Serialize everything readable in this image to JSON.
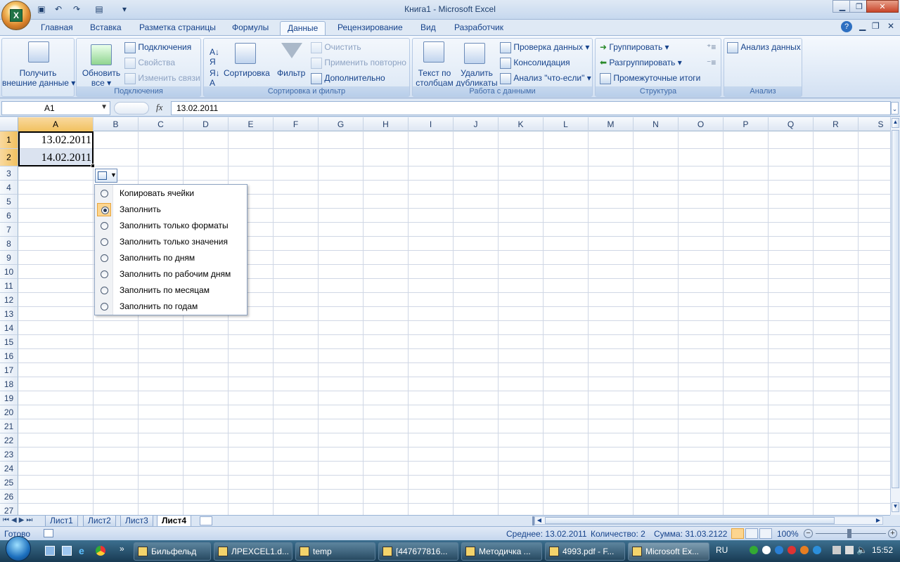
{
  "window": {
    "title": "Книга1 - Microsoft Excel",
    "minimize": "▁",
    "restore": "❐",
    "close": "✕"
  },
  "qat": {
    "save": "💾",
    "undo": "↶",
    "redo": "↷",
    "custom": "▾"
  },
  "tabs": [
    "Главная",
    "Вставка",
    "Разметка страницы",
    "Формулы",
    "Данные",
    "Рецензирование",
    "Вид",
    "Разработчик"
  ],
  "active_tab": "Данные",
  "ribbon": {
    "get_external": {
      "line1": "Получить",
      "line2": "внешние данные ▾"
    },
    "connections": {
      "refresh_line1": "Обновить",
      "refresh_line2": "все ▾",
      "connections": "Подключения",
      "properties": "Свойства",
      "edit_links": "Изменить связи",
      "label": "Подключения"
    },
    "sort_filter": {
      "sort": "Сортировка",
      "filter": "Фильтр",
      "clear": "Очистить",
      "reapply": "Применить повторно",
      "advanced": "Дополнительно",
      "label": "Сортировка и фильтр"
    },
    "data_tools": {
      "text_to_columns_1": "Текст по",
      "text_to_columns_2": "столбцам",
      "remove_dup_1": "Удалить",
      "remove_dup_2": "дубликаты",
      "validation": "Проверка данных ▾",
      "consolidate": "Консолидация",
      "whatif": "Анализ \"что-если\" ▾",
      "label": "Работа с данными"
    },
    "outline": {
      "group": "Группировать ▾",
      "ungroup": "Разгруппировать ▾",
      "subtotal": "Промежуточные итоги",
      "label": "Структура"
    },
    "analysis": {
      "data_analysis": "Анализ данных",
      "label": "Анализ"
    }
  },
  "formula_bar": {
    "name_box": "A1",
    "fx": "fx",
    "value": "13.02.2011"
  },
  "columns": [
    "A",
    "B",
    "C",
    "D",
    "E",
    "F",
    "G",
    "H",
    "I",
    "J",
    "K",
    "L",
    "M",
    "N",
    "O",
    "P",
    "Q",
    "R",
    "S"
  ],
  "rows": [
    "1",
    "2",
    "3",
    "4",
    "5",
    "6",
    "7",
    "8",
    "9",
    "10",
    "11",
    "12",
    "13",
    "14",
    "15",
    "16",
    "17",
    "18",
    "19",
    "20",
    "21",
    "22",
    "23",
    "24",
    "25",
    "26",
    "27"
  ],
  "cells": {
    "A1": "13.02.2011",
    "A2": "14.02.2011"
  },
  "autofill_menu": [
    {
      "label": "Копировать ячейки",
      "selected": false
    },
    {
      "label": "Заполнить",
      "selected": true
    },
    {
      "label": "Заполнить только форматы",
      "selected": false
    },
    {
      "label": "Заполнить только значения",
      "selected": false
    },
    {
      "label": "Заполнить по дням",
      "selected": false
    },
    {
      "label": "Заполнить по рабочим дням",
      "selected": false
    },
    {
      "label": "Заполнить по месяцам",
      "selected": false
    },
    {
      "label": "Заполнить по годам",
      "selected": false
    }
  ],
  "sheets": [
    "Лист1",
    "Лист2",
    "Лист3",
    "Лист4"
  ],
  "active_sheet": "Лист4",
  "status": {
    "ready": "Готово",
    "average": "Среднее: 13.02.2011",
    "count": "Количество: 2",
    "sum": "Сумма: 31.03.2122",
    "zoom": "100%"
  },
  "taskbar": {
    "items": [
      {
        "label": "Бильфельд",
        "active": false
      },
      {
        "label": "ЛРEXCEL1.d...",
        "active": false
      },
      {
        "label": "temp",
        "active": false
      },
      {
        "label": "[447677816...",
        "active": false
      },
      {
        "label": "Методичка ...",
        "active": false
      },
      {
        "label": "4993.pdf - F...",
        "active": false
      },
      {
        "label": "Microsoft Ex...",
        "active": true
      }
    ],
    "lang": "RU",
    "time": "15:52"
  }
}
